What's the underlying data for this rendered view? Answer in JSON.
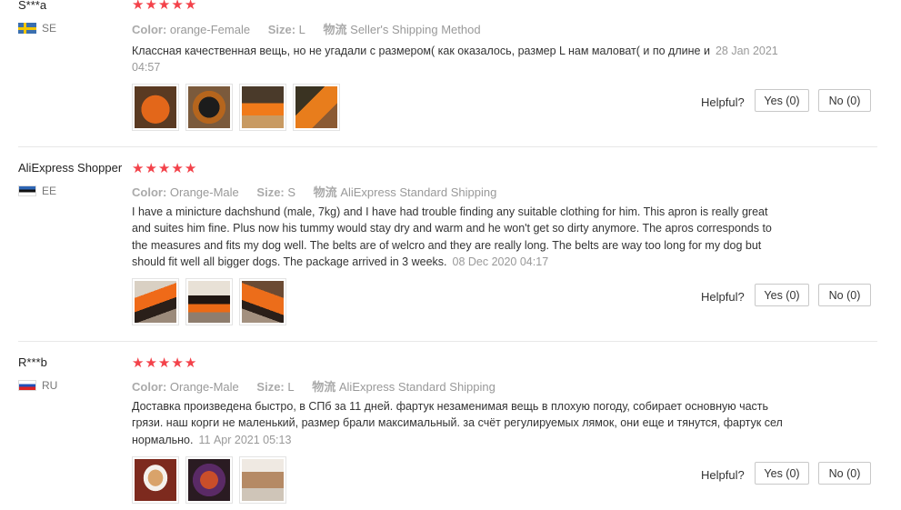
{
  "labels": {
    "color": "Color:",
    "size": "Size:",
    "shipping": "物流",
    "helpful": "Helpful?"
  },
  "reviews": [
    {
      "user": "S***a",
      "country": "SE",
      "rating": 5,
      "color": "orange-Female",
      "size": "L",
      "shipping": "Seller's Shipping Method",
      "text": "Классная качественная вещь, но не угадали с размером( как оказалось, размер L нам маловат( и по длине и",
      "date": "28 Jan 2021 04:57",
      "photo_count": 4,
      "yes_label": "Yes (0)",
      "no_label": "No (0)"
    },
    {
      "user": "AliExpress Shopper",
      "country": "EE",
      "rating": 5,
      "color": "Orange-Male",
      "size": "S",
      "shipping": "AliExpress Standard Shipping",
      "text": "I have a minicture dachshund (male, 7kg) and I have had trouble finding any suitable clothing for him. This apron is really great and suites him fine. Plus now his tummy would stay dry and warm and he won't get so dirty anymore. The apros corresponds to the measures and fits my dog well. The belts are of welcro and they are really long. The belts are way too long for my dog but should fit well all bigger dogs. The package arrived in 3 weeks.",
      "date": "08 Dec 2020 04:17",
      "photo_count": 3,
      "yes_label": "Yes (0)",
      "no_label": "No (0)"
    },
    {
      "user": "R***b",
      "country": "RU",
      "rating": 5,
      "color": "Orange-Male",
      "size": "L",
      "shipping": "AliExpress Standard Shipping",
      "text": "Доставка произведена быстро, в СПб за 11 дней. фартук незаменимая вещь в плохую погоду, собирает основную часть грязи. наш корги не маленький, размер брали максимальный. за счёт регулируемых лямок, они еще и тянутся, фартук сел нормально.",
      "date": "11 Apr 2021 05:13",
      "photo_count": 3,
      "yes_label": "Yes (0)",
      "no_label": "No (0)"
    }
  ],
  "star_glyph": "★",
  "colors": {
    "star": "#f3424a",
    "muted": "#999999",
    "border": "#c8c8c8"
  }
}
